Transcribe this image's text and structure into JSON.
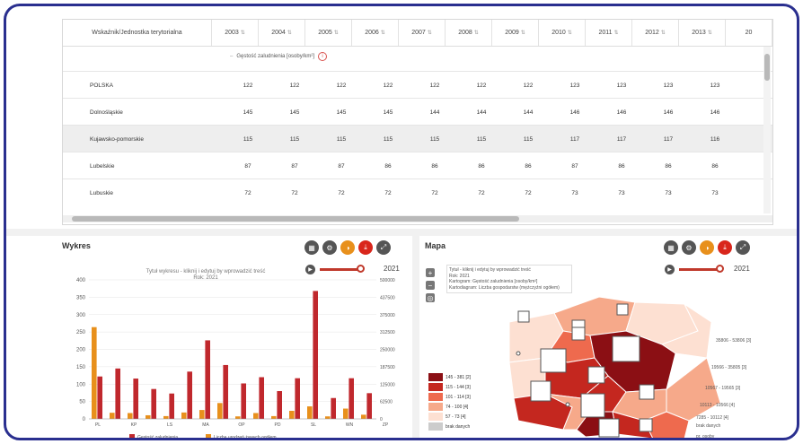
{
  "table": {
    "header_first": "Wskaźnik/Jednostka terytorialna",
    "years": [
      "2003",
      "2004",
      "2005",
      "2006",
      "2007",
      "2008",
      "2009",
      "2010",
      "2011",
      "2012",
      "2013",
      "20"
    ],
    "subheader": "Gęstość zaludnienia [osoby/km²]",
    "rows": [
      {
        "name": "POLSKA",
        "values": [
          "122",
          "122",
          "122",
          "122",
          "122",
          "122",
          "122",
          "123",
          "123",
          "123",
          "123"
        ]
      },
      {
        "name": "Dolnośląskie",
        "values": [
          "145",
          "145",
          "145",
          "145",
          "144",
          "144",
          "144",
          "146",
          "146",
          "146",
          "146"
        ]
      },
      {
        "name": "Kujawsko-pomorskie",
        "values": [
          "115",
          "115",
          "115",
          "115",
          "115",
          "115",
          "115",
          "117",
          "117",
          "117",
          "116"
        ]
      },
      {
        "name": "Lubelskie",
        "values": [
          "87",
          "87",
          "87",
          "86",
          "86",
          "86",
          "86",
          "87",
          "86",
          "86",
          "86"
        ]
      },
      {
        "name": "Lubuskie",
        "values": [
          "72",
          "72",
          "72",
          "72",
          "72",
          "72",
          "72",
          "73",
          "73",
          "73",
          "73"
        ]
      }
    ]
  },
  "chart_panel": {
    "title": "Wykres",
    "year": "2021",
    "icons": [
      "table-icon",
      "gear-icon",
      "palette-icon",
      "download-icon",
      "expand-icon"
    ]
  },
  "map_panel": {
    "title": "Mapa",
    "year": "2021",
    "icons": [
      "table-icon",
      "gear-icon",
      "palette-icon",
      "download-icon",
      "expand-icon"
    ],
    "tooltip": [
      "Tytuł - kliknij i edytuj by wprowadzić treść",
      "Rok: 2021",
      "Kartogram: Gęstość zaludnienia [osoby/km²]",
      "Kartodiagram: Liczba gospodarstw (mężczyźni ogółem)"
    ],
    "legend": [
      {
        "label": "145 - 381 [2]",
        "color": "#8b0f14"
      },
      {
        "label": "115 - 144 [3]",
        "color": "#c4271f"
      },
      {
        "label": "101 - 114 [3]",
        "color": "#ee6a4e"
      },
      {
        "label": "74 - 100 [4]",
        "color": "#f6a98a"
      },
      {
        "label": "57 - 73 [4]",
        "color": "#fde0d2"
      },
      {
        "label": "brak danych",
        "color": "#cccccc"
      }
    ],
    "size_legend": [
      "35806 - 53806 [3]",
      "19566 - 35805 [3]",
      "10567 - 19565 [3]",
      "10113 - 10566 [4]",
      "7285 - 10112 [4]",
      "brak danych",
      "pr. osoby"
    ]
  },
  "chart_data": {
    "type": "bar",
    "title": "Tytuł wykresu - kliknij i edytuj by wprowadzić treść",
    "subtitle": "Rok: 2021",
    "categories": [
      "DŚ",
      "KP",
      "LB",
      "LS",
      "ŁD",
      "MP",
      "MZ",
      "OP",
      "PK",
      "PD",
      "PM",
      "ŚL",
      "ŚK",
      "WM",
      "WP",
      "ZP"
    ],
    "tick_labels": [
      "PL",
      "KP",
      "LS",
      "MA",
      "OP",
      "PD",
      "SL",
      "WN",
      "ZP"
    ],
    "series": [
      {
        "name": "Gęstość zaludnienia",
        "axis": "left",
        "values": [
          122,
          145,
          116,
          86,
          73,
          136,
          226,
          155,
          102,
          120,
          80,
          117,
          368,
          60,
          117,
          74
        ]
      },
      {
        "name": "Liczba urodzeń żywych ogółem",
        "axis": "right",
        "values": [
          330000,
          22000,
          21000,
          13000,
          10000,
          23000,
          32000,
          57000,
          9000,
          21000,
          10000,
          29000,
          45000,
          9000,
          37000,
          15000
        ]
      }
    ],
    "y_left": {
      "min": 0,
      "max": 400,
      "ticks": [
        0,
        50,
        100,
        150,
        200,
        250,
        300,
        350,
        400
      ]
    },
    "y_right": {
      "min": 0,
      "max": 500000,
      "ticks": [
        "0",
        "62500",
        "125000",
        "187500",
        "250000",
        "312500",
        "375000",
        "437500",
        "500000"
      ]
    },
    "colors": {
      "left": "#c0282d",
      "right": "#e8901c"
    }
  }
}
